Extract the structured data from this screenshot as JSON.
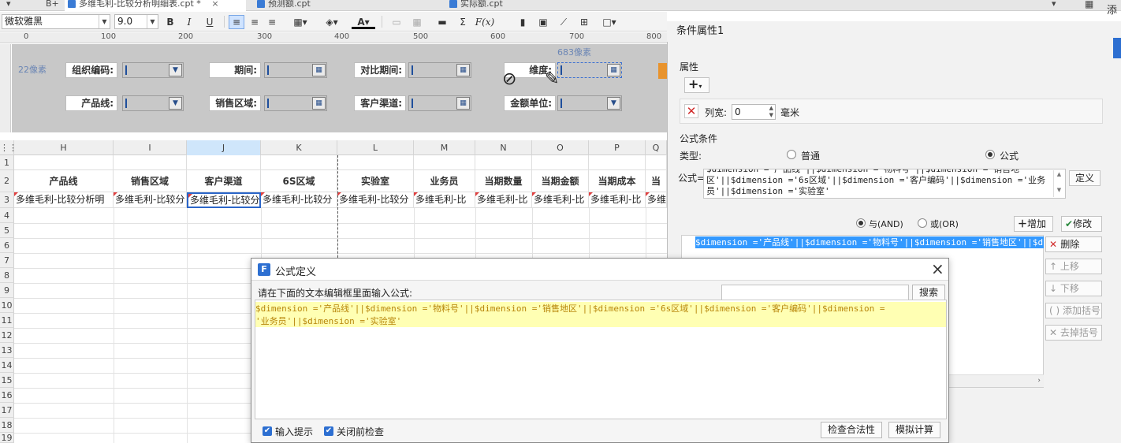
{
  "tabs": [
    {
      "label": "B+"
    },
    {
      "label": "多维毛利-比较分析明细表.cpt *",
      "active": true
    },
    {
      "label": "预测额.cpt"
    },
    {
      "label": "实际额.cpt"
    }
  ],
  "toolbar": {
    "font_name": "微软雅黑",
    "font_size": "9.0",
    "bold": "B",
    "italic": "I",
    "underline": "U",
    "fx_label": "F(x)"
  },
  "ruler": {
    "labels": [
      "0",
      "100",
      "200",
      "300",
      "400",
      "500",
      "600",
      "700",
      "800"
    ]
  },
  "param_panel": {
    "px_note_left": "22像素",
    "px_note_right": "683像素",
    "labels": [
      "组织编码:",
      "期间:",
      "对比期间:",
      "维度:",
      "产品线:",
      "销售区域:",
      "客户渠道:",
      "金额单位:"
    ]
  },
  "grid": {
    "columns": [
      "H",
      "I",
      "J",
      "K",
      "L",
      "M",
      "N",
      "O",
      "P",
      "Q"
    ],
    "rows": [
      "1",
      "2",
      "3",
      "4",
      "5",
      "6",
      "7",
      "8",
      "9",
      "10",
      "11",
      "12",
      "13",
      "14",
      "15",
      "16",
      "17",
      "18",
      "19"
    ],
    "header_row": [
      "产品线",
      "销售区域",
      "客户渠道",
      "6S区域",
      "实验室",
      "业务员",
      "当期数量",
      "当期金额",
      "当期成本",
      "当"
    ],
    "value_row": [
      "多维毛利-比较分析明",
      "多维毛利-比较分",
      "多维毛利-比较分",
      "多维毛利-比较分",
      "多维毛利-比较分",
      "多维毛利-比",
      "多维毛利-比",
      "多维毛利-比",
      "多维毛利-比",
      "多维"
    ]
  },
  "right_panel": {
    "title": "条件属性1",
    "section_attr": "属性",
    "add_symbol": "+",
    "col_width_label": "列宽:",
    "col_width_value": "0",
    "col_width_unit": "毫米",
    "section_formula": "公式条件",
    "type_label": "类型:",
    "type_normal": "普通",
    "type_formula": "公式",
    "formula_label": "公式=",
    "formula_line1": "$dimension ='产品线'||$dimension ='物料号'||$dimension ='销售地",
    "formula_line2": "区'||$dimension ='6s区域'||$dimension ='客户编码'||$dimension ='业务",
    "formula_line3": "员'||$dimension ='实验室'",
    "define_button": "定义",
    "and_label": "与(AND)",
    "or_label": "或(OR)",
    "add_button": "增加",
    "modify_button": "修改",
    "condition_item": "$dimension ='产品线'||$dimension ='物料号'||$dimension ='销售地区'||$dimen",
    "delete_button": "删除",
    "move_up": "上移",
    "move_down": "下移",
    "add_bracket": "添加括号",
    "remove_bracket": "去掉括号",
    "top_right_glyph": "添"
  },
  "dialog": {
    "title": "公式定义",
    "instruction": "请在下面的文本编辑框里面输入公式:",
    "search_placeholder": "",
    "search_button": "搜索",
    "formula_line1": "$dimension ='产品线'||$dimension ='物料号'||$dimension ='销售地区'||$dimension ='6s区域'||$dimension ='客户编码'||$dimension =",
    "formula_line2": "'业务员'||$dimension ='实验室'",
    "hint_label": "输入提示",
    "check_before_close": "关闭前检查",
    "validate_button": "检查合法性",
    "simulate_button": "模拟计算",
    "close_symbol": "×"
  },
  "colors": {
    "accent": "#2d6fd1",
    "param_bg": "#c8c8c8",
    "formula_highlight": "#ffffb3",
    "formula_text": "#b8860b",
    "selection": "#3399ff"
  }
}
